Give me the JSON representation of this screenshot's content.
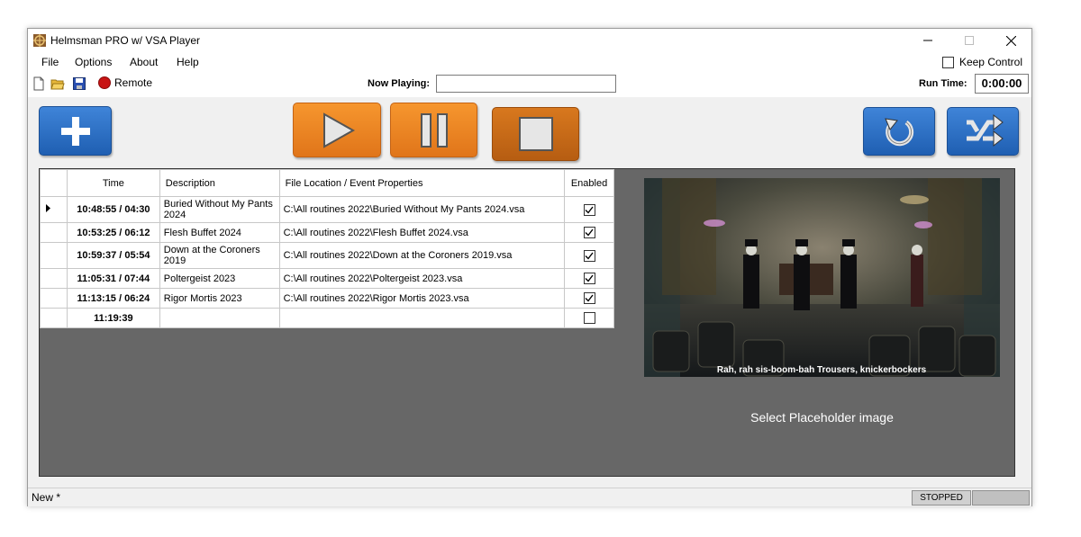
{
  "window": {
    "title": "Helmsman PRO w/ VSA Player"
  },
  "menu": {
    "file": "File",
    "options": "Options",
    "about": "About",
    "help": "Help",
    "keep_control": "Keep Control"
  },
  "toolbar": {
    "remote": "Remote",
    "now_playing_label": "Now Playing:",
    "now_playing_value": "",
    "run_time_label": "Run Time:",
    "run_time_value": "0:00:00"
  },
  "grid": {
    "headers": {
      "time": "Time",
      "description": "Description",
      "file": "File Location / Event Properties",
      "enabled": "Enabled"
    },
    "rows": [
      {
        "time": "10:48:55 / 04:30",
        "description": "Buried Without My Pants 2024",
        "file": "C:\\All routines 2022\\Buried Without My Pants 2024.vsa",
        "enabled": true,
        "selected": true
      },
      {
        "time": "10:53:25 / 06:12",
        "description": "Flesh Buffet 2024",
        "file": "C:\\All routines 2022\\Flesh Buffet 2024.vsa",
        "enabled": true,
        "selected": false
      },
      {
        "time": "10:59:37 / 05:54",
        "description": "Down at the Coroners 2019",
        "file": "C:\\All routines 2022\\Down at the Coroners 2019.vsa",
        "enabled": true,
        "selected": false
      },
      {
        "time": "11:05:31 / 07:44",
        "description": "Poltergeist 2023",
        "file": "C:\\All routines 2022\\Poltergeist 2023.vsa",
        "enabled": true,
        "selected": false
      },
      {
        "time": "11:13:15 / 06:24",
        "description": "Rigor Mortis 2023",
        "file": "C:\\All routines 2022\\Rigor Mortis 2023.vsa",
        "enabled": true,
        "selected": false
      },
      {
        "time": "11:19:39",
        "description": "",
        "file": "",
        "enabled": false,
        "selected": false
      }
    ]
  },
  "preview": {
    "caption": "Rah, rah sis-boom-bah Trousers, knickerbockers",
    "placeholder_label": "Select Placeholder image"
  },
  "status": {
    "document": "New  *",
    "state": "STOPPED"
  },
  "colors": {
    "blue_button": "#2a6ec4",
    "orange_button": "#f08a24",
    "orange_dark_button": "#c96a16",
    "panel_bg": "#676767"
  }
}
